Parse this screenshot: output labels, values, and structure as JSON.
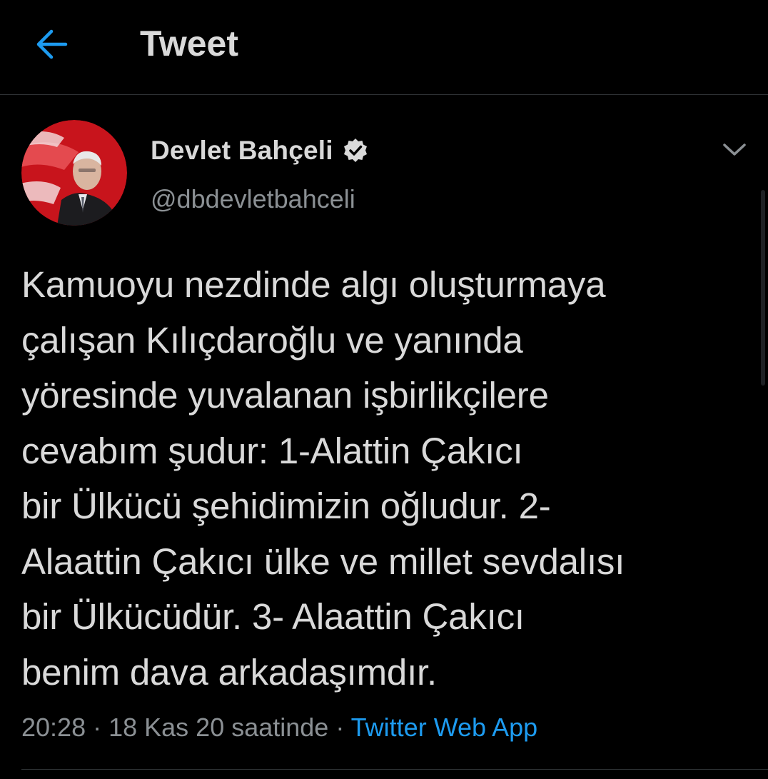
{
  "header": {
    "title": "Tweet",
    "back_icon": "arrow-left-icon",
    "accent_color": "#1d9bf0"
  },
  "author": {
    "name": "Devlet Bahçeli",
    "handle": "@dbdevletbahceli",
    "verified_icon": "verified-badge-icon"
  },
  "tweet": {
    "text": "Kamuoyu nezdinde algı oluşturmaya\nçalışan Kılıçdaroğlu ve yanında\nyöresinde yuvalanan işbirlikçilere\ncevabım şudur: 1-Alattin Çakıcı\nbir Ülkücü şehidimizin oğludur. 2-\nAlaattin Çakıcı ülke ve millet sevdalısı\nbir Ülkücüdür. 3- Alaattin Çakıcı\nbenim dava arkadaşımdır.",
    "time": "20:28",
    "date": "18 Kas 20 saatinde",
    "source": "Twitter Web App",
    "separator": " · "
  },
  "colors": {
    "background": "#000000",
    "text": "#d9d9d9",
    "secondary_text": "#8b9094",
    "link": "#1d9bf0",
    "divider": "#2f3336"
  }
}
